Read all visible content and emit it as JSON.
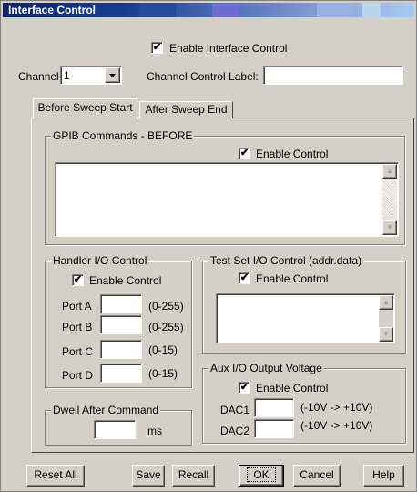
{
  "window": {
    "title": "Interface Control"
  },
  "top": {
    "enable_interface_label": "Enable Interface Control",
    "enable_interface_checked": true,
    "channel_label": "Channel",
    "channel_value": "1",
    "channel_control_label": "Channel Control Label:",
    "channel_control_value": ""
  },
  "tabs": [
    {
      "label": "Before Sweep Start",
      "active": true
    },
    {
      "label": "After Sweep End",
      "active": false
    }
  ],
  "gpib": {
    "title": "GPIB Commands - BEFORE",
    "enable_label": "Enable Control",
    "enable_checked": true,
    "text": ""
  },
  "handler": {
    "title": "Handler I/O Control",
    "enable_label": "Enable Control",
    "enable_checked": true,
    "ports": [
      {
        "label": "Port A",
        "value": "",
        "range": "(0-255)"
      },
      {
        "label": "Port B",
        "value": "",
        "range": "(0-255)"
      },
      {
        "label": "Port C",
        "value": "",
        "range": "(0-15)"
      },
      {
        "label": "Port D",
        "value": "",
        "range": "(0-15)"
      }
    ]
  },
  "testset": {
    "title": "Test Set I/O Control (addr.data)",
    "enable_label": "Enable Control",
    "enable_checked": true,
    "text": ""
  },
  "dwell": {
    "title": "Dwell After Command",
    "value": "",
    "unit": "ms"
  },
  "aux": {
    "title": "Aux I/O Output Voltage",
    "enable_label": "Enable Control",
    "enable_checked": true,
    "dacs": [
      {
        "label": "DAC1",
        "value": "",
        "range": "(-10V -> +10V)"
      },
      {
        "label": "DAC2",
        "value": "",
        "range": "(-10V -> +10V)"
      }
    ]
  },
  "buttons": {
    "reset_all": "Reset All",
    "save": "Save",
    "recall": "Recall",
    "ok": "OK",
    "cancel": "Cancel",
    "help": "Help"
  },
  "check_mark": "✔",
  "icons": {
    "dropdown": "chevron-down-icon",
    "scroll_up": "arrow-up-icon",
    "scroll_down": "arrow-down-icon"
  }
}
